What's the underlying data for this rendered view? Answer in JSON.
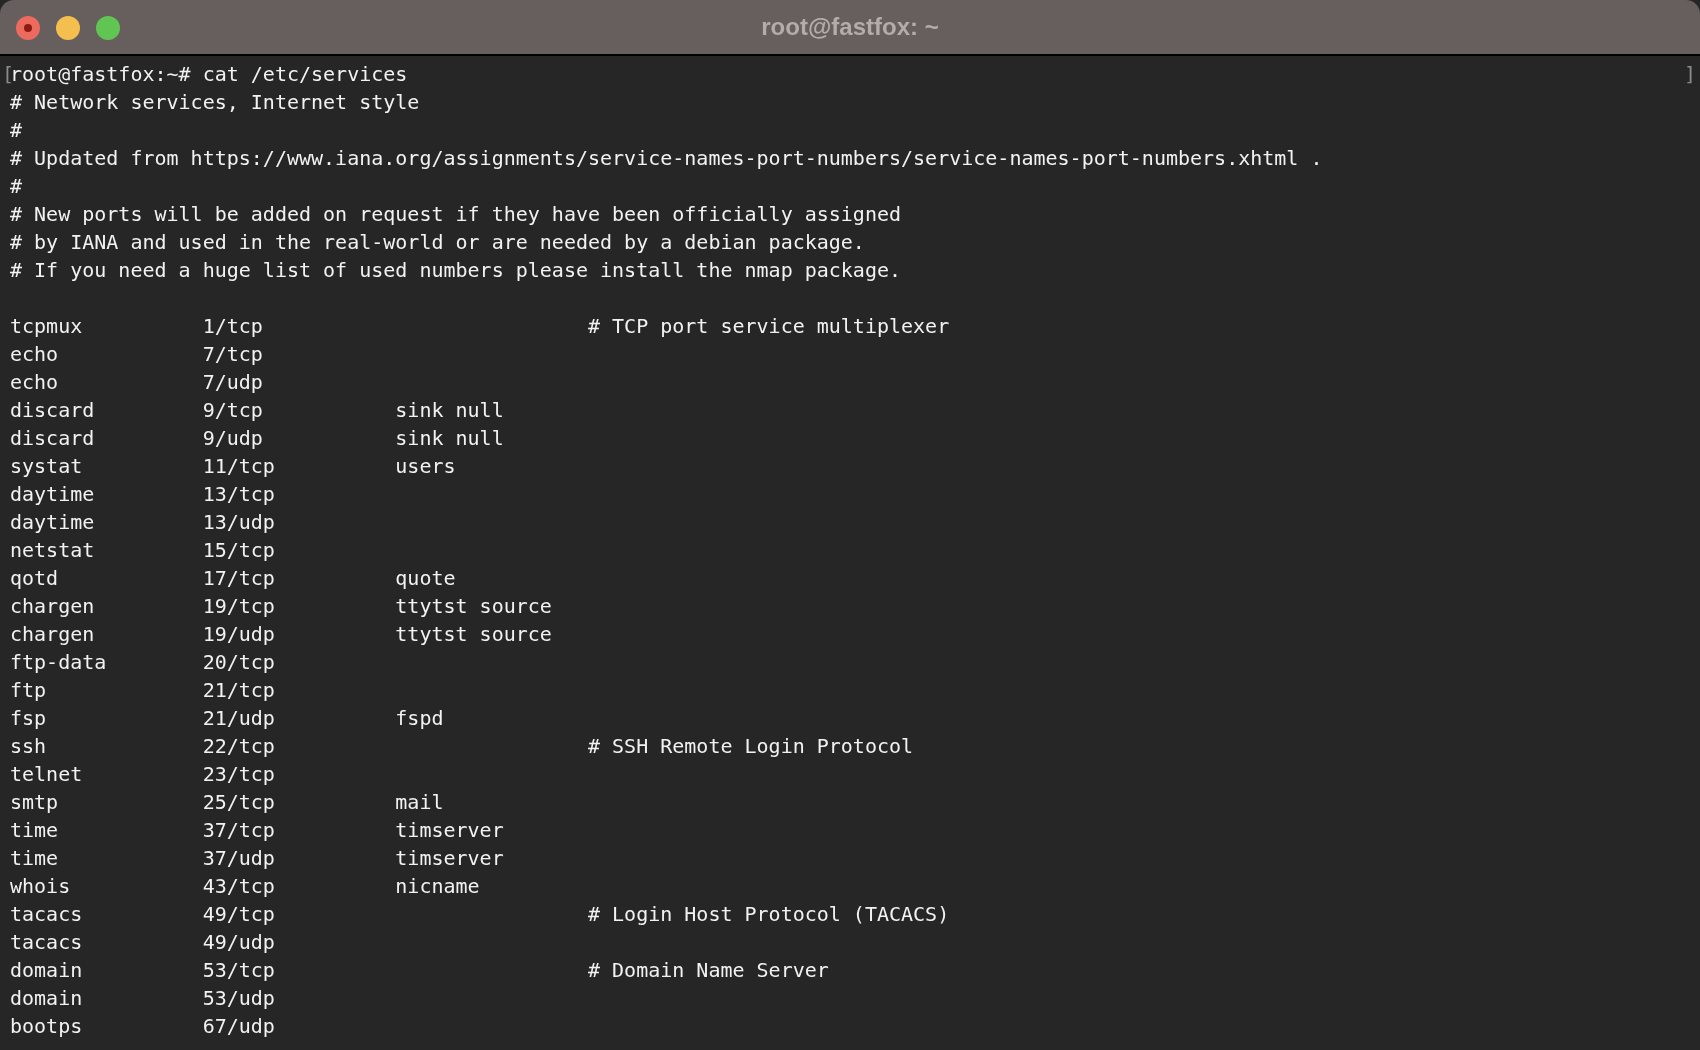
{
  "window": {
    "title": "root@fastfox: ~"
  },
  "marks": {
    "left": "[",
    "right": "]"
  },
  "lines": [
    "root@fastfox:~# cat /etc/services",
    "# Network services, Internet style",
    "#",
    "# Updated from https://www.iana.org/assignments/service-names-port-numbers/service-names-port-numbers.xhtml .",
    "#",
    "# New ports will be added on request if they have been officially assigned",
    "# by IANA and used in the real-world or are needed by a debian package.",
    "# If you need a huge list of used numbers please install the nmap package."
  ],
  "entries": [
    "tcpmux          1/tcp                           # TCP port service multiplexer",
    "echo            7/tcp",
    "echo            7/udp",
    "discard         9/tcp           sink null",
    "discard         9/udp           sink null",
    "systat          11/tcp          users",
    "daytime         13/tcp",
    "daytime         13/udp",
    "netstat         15/tcp",
    "qotd            17/tcp          quote",
    "chargen         19/tcp          ttytst source",
    "chargen         19/udp          ttytst source",
    "ftp-data        20/tcp",
    "ftp             21/tcp",
    "fsp             21/udp          fspd",
    "ssh             22/tcp                          # SSH Remote Login Protocol",
    "telnet          23/tcp",
    "smtp            25/tcp          mail",
    "time            37/tcp          timserver",
    "time            37/udp          timserver",
    "whois           43/tcp          nicname",
    "tacacs          49/tcp                          # Login Host Protocol (TACACS)",
    "tacacs          49/udp",
    "domain          53/tcp                          # Domain Name Server",
    "domain          53/udp",
    "bootps          67/udp"
  ]
}
